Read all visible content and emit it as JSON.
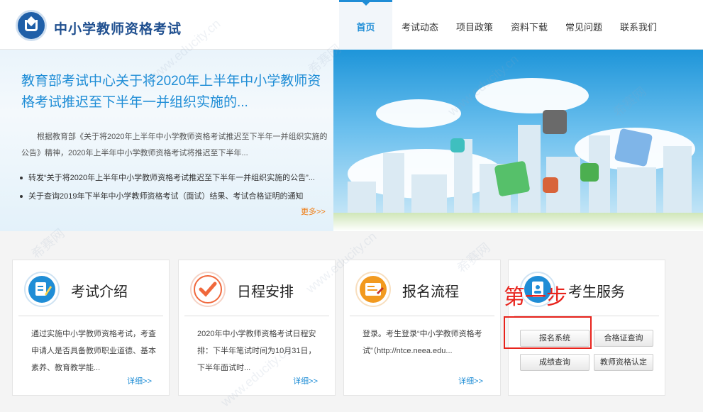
{
  "header": {
    "site_title": "中小学教师资格考试",
    "nav": [
      {
        "label": "首页",
        "active": true
      },
      {
        "label": "考试动态",
        "active": false
      },
      {
        "label": "项目政策",
        "active": false
      },
      {
        "label": "资料下载",
        "active": false
      },
      {
        "label": "常见问题",
        "active": false
      },
      {
        "label": "联系我们",
        "active": false
      }
    ]
  },
  "banner": {
    "headline": "教育部考试中心关于将2020年上半年中小学教师资格考试推迟至下半年一并组织实施的...",
    "summary": "根据教育部《关于将2020年上半年中小学教师资格考试推迟至下半年一并组织实施的公告》精神，2020年上半年中小学教师资格考试将推迟至下半年...",
    "news": [
      "转发“关于将2020年上半年中小学教师资格考试推迟至下半年一并组织实施的公告”...",
      "关于查询2019年下半年中小学教师资格考试（面试）结果、考试合格证明的通知"
    ],
    "more": "更多>>"
  },
  "cards": [
    {
      "title": "考试介绍",
      "icon": "document-edit-icon",
      "text": "通过实施中小学教师资格考试，考查申请人是否具备教师职业道德、基本素养、教育教学能...",
      "detail": "详细>>"
    },
    {
      "title": "日程安排",
      "icon": "checkmark-icon",
      "text": "2020年中小学教师资格考试日程安排：下半年笔试时间为10月31日，下半年面试时...",
      "detail": "详细>>"
    },
    {
      "title": "报名流程",
      "icon": "registration-form-icon",
      "text": "登录。考生登录“中小学教师资格考试”（http://ntce.neea.edu...",
      "detail": "详细>>"
    },
    {
      "title": "考生服务",
      "icon": "contacts-book-icon",
      "text": "",
      "detail": ""
    }
  ],
  "services": {
    "buttons": [
      "报名系统",
      "合格证查询",
      "成绩查询",
      "教师资格认定"
    ]
  },
  "annotation": {
    "label": "第一步",
    "color": "#e8231c"
  },
  "watermarks": [
    "希赛网",
    "www.educity.cn"
  ],
  "colors": {
    "accent": "#1f8dd6",
    "more": "#ef7d14",
    "title": "#1f4f8f"
  }
}
